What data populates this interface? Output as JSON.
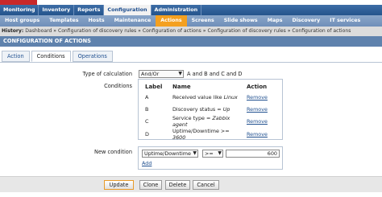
{
  "main_nav": [
    "Monitoring",
    "Inventory",
    "Reports",
    "Configuration",
    "Administration"
  ],
  "main_nav_active": "Configuration",
  "sub_nav": [
    "Host groups",
    "Templates",
    "Hosts",
    "Maintenance",
    "Actions",
    "Screens",
    "Slide shows",
    "Maps",
    "Discovery",
    "IT services"
  ],
  "sub_nav_active": "Actions",
  "history": {
    "label": "History:",
    "items": [
      "Dashboard",
      "Configuration of discovery rules",
      "Configuration of actions",
      "Configuration of discovery rules",
      "Configuration of actions"
    ],
    "separator": "»"
  },
  "page_title": "CONFIGURATION OF ACTIONS",
  "tabs": [
    "Action",
    "Conditions",
    "Operations"
  ],
  "active_tab": "Conditions",
  "calculation": {
    "label": "Type of calculation",
    "value": "And/Or",
    "formula": "A and B and C and D"
  },
  "conditions": {
    "label": "Conditions",
    "headers": {
      "label": "Label",
      "name": "Name",
      "action": "Action"
    },
    "rows": [
      {
        "label": "A",
        "name": "Received value like",
        "op": "Linux",
        "action": "Remove"
      },
      {
        "label": "B",
        "name": "Discovery status =",
        "op": "Up",
        "action": "Remove"
      },
      {
        "label": "C",
        "name": "Service type =",
        "op": "Zabbix agent",
        "action": "Remove"
      },
      {
        "label": "D",
        "name": "Uptime/Downtime >=",
        "op": "3600",
        "action": "Remove"
      }
    ]
  },
  "new_condition": {
    "label": "New condition",
    "type_value": "Uptime/Downtime",
    "operator_value": ">=",
    "input_value": "600",
    "add_label": "Add"
  },
  "buttons": {
    "update": "Update",
    "clone": "Clone",
    "delete": "Delete",
    "cancel": "Cancel"
  },
  "colors": {
    "nav": "#2f5f98",
    "subnav_active": "#f4a020",
    "header": "#5f82ad",
    "logo": "#c8282a"
  }
}
